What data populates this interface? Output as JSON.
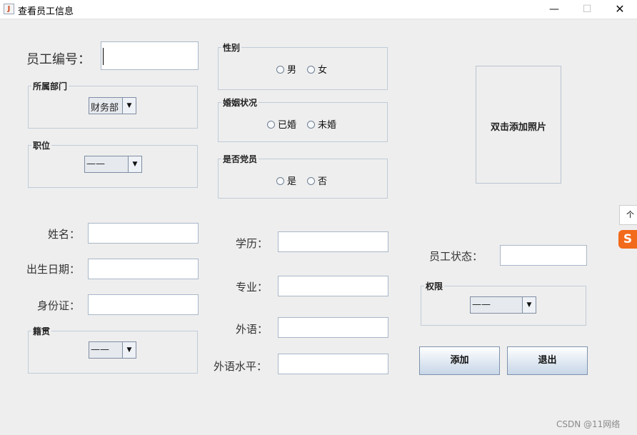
{
  "window": {
    "title": "查看员工信息",
    "icon_glyph": "J",
    "minimize": "—",
    "maximize": "☐",
    "close": "✕"
  },
  "form": {
    "emp_no_label": "员工编号：",
    "emp_no_value": "",
    "dept": {
      "title": "所属部门",
      "selected": "财务部"
    },
    "position": {
      "title": "职位",
      "selected": "——"
    },
    "gender": {
      "title": "性别",
      "options": [
        "男",
        "女"
      ]
    },
    "marital": {
      "title": "婚姻状况",
      "options": [
        "已婚",
        "未婚"
      ]
    },
    "party": {
      "title": "是否党员",
      "options": [
        "是",
        "否"
      ]
    },
    "photo_label": "双击添加照片",
    "name_label": "姓名：",
    "birth_label": "出生日期：",
    "id_label": "身份证：",
    "native": {
      "title": "籍贯",
      "selected": "——"
    },
    "edu_label": "学历：",
    "major_label": "专业：",
    "lang_label": "外语：",
    "lang_level_label": "外语水平：",
    "status_label": "员工状态：",
    "permission": {
      "title": "权限",
      "selected": "——"
    },
    "add_button": "添加",
    "exit_button": "退出",
    "combo_arrow": "▼"
  },
  "overlay": {
    "tooltip_text": "个性",
    "ime_glyph": "S",
    "watermark": "CSDN @11网络"
  },
  "colors": {
    "background": "#eeeeee",
    "border": "#c0cbd8",
    "button_gradient_bottom": "#c8d6e7"
  }
}
